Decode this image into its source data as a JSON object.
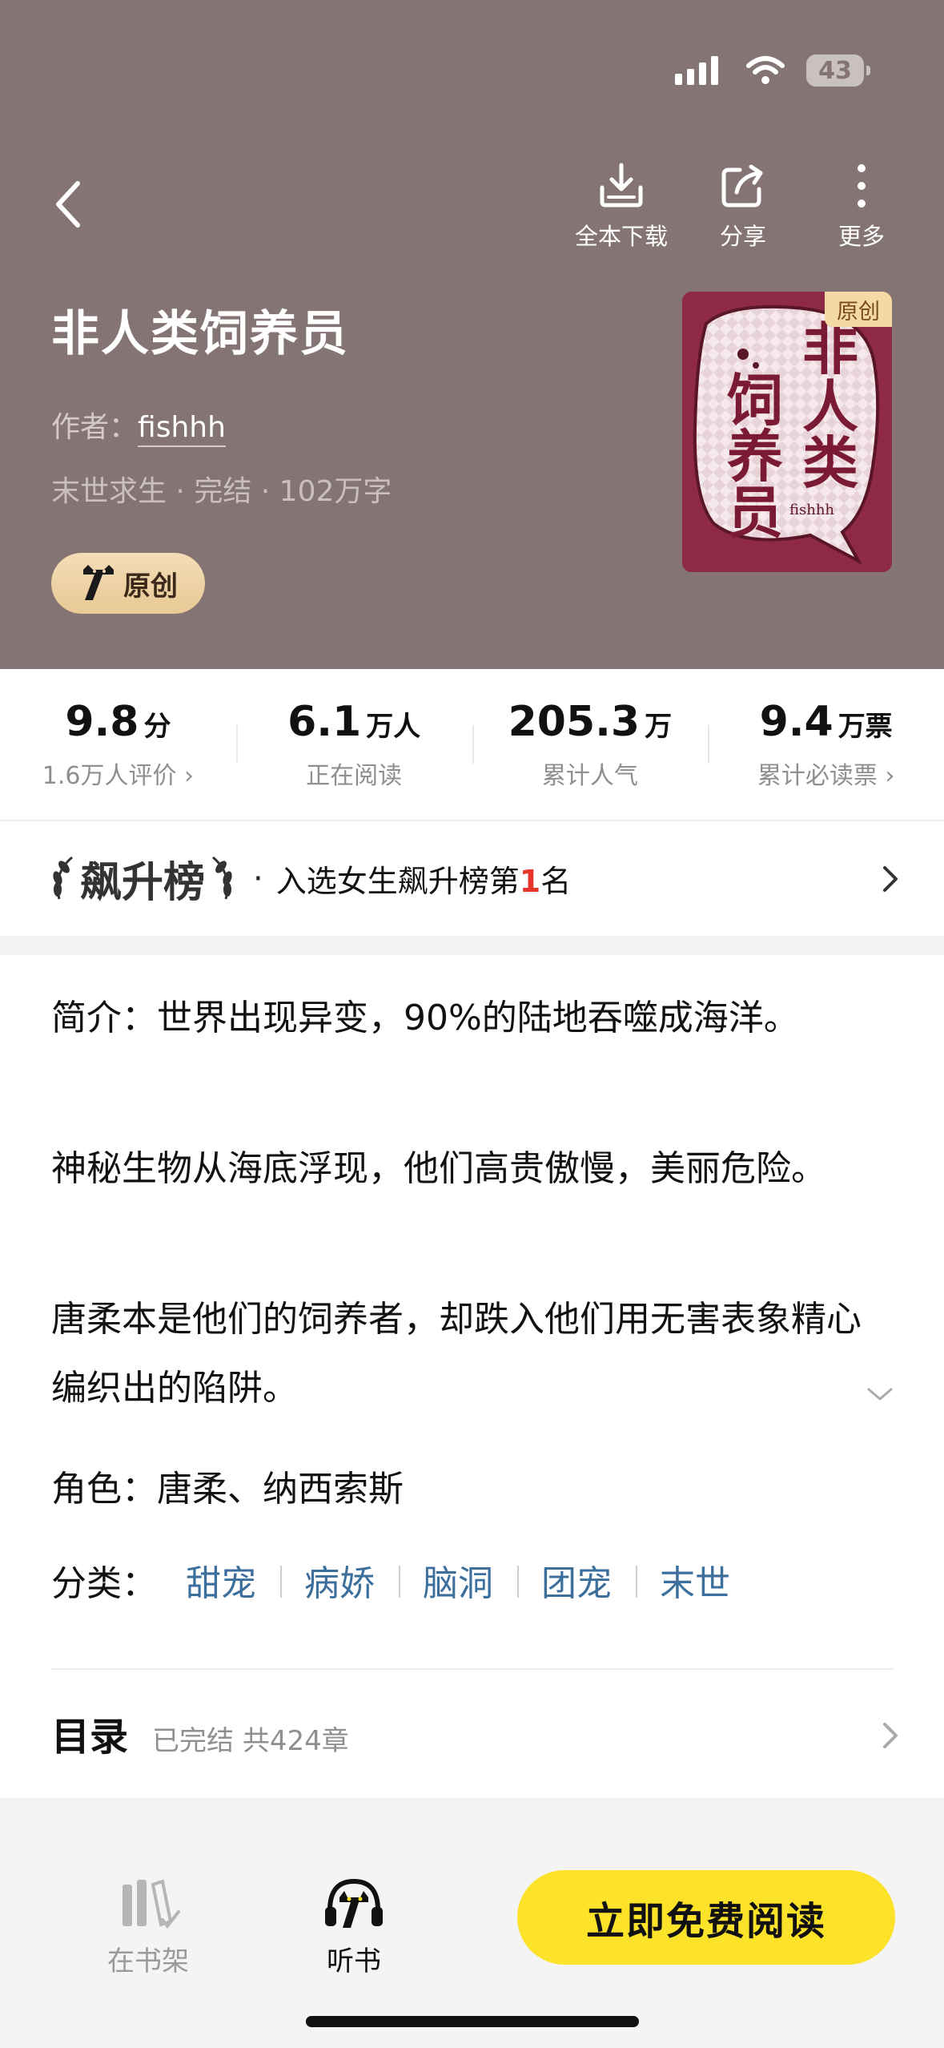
{
  "status_bar": {
    "battery": "43"
  },
  "toolbar": {
    "download_label": "全本下载",
    "share_label": "分享",
    "more_label": "更多"
  },
  "book": {
    "title": "非人类饲养员",
    "author_prefix": "作者：",
    "author": "fishhh",
    "meta": "末世求生 · 完结 · 102万字",
    "badge_label": "原创",
    "cover": {
      "tag": "原创",
      "title_chars": [
        "非",
        "人",
        "类",
        "饲",
        "养",
        "员"
      ],
      "author_mark": "fishhh"
    }
  },
  "stats": [
    {
      "num": "9.8",
      "unit": "分",
      "caption": "1.6万人评价"
    },
    {
      "num": "6.1",
      "unit": "万人",
      "caption": "正在阅读"
    },
    {
      "num": "205.3",
      "unit": "万",
      "caption": "累计人气"
    },
    {
      "num": "9.4",
      "unit": "万票",
      "caption": "累计必读票"
    }
  ],
  "rank": {
    "logo_text": "飙升榜",
    "dot": "·",
    "text_before": "入选女生飙升榜第",
    "rank_number": "1",
    "text_after": "名"
  },
  "intro": {
    "p1": "简介：世界出现异变，90%的陆地吞噬成海洋。",
    "p2": "神秘生物从海底浮现，他们高贵傲慢，美丽危险。",
    "p3": "唐柔本是他们的饲养者，却跌入他们用无害表象精心编织出的陷阱。",
    "role": "角色：唐柔、纳西索斯",
    "category_key": "分类：",
    "categories": [
      "甜宠",
      "病娇",
      "脑洞",
      "团宠",
      "末世"
    ]
  },
  "toc": {
    "title": "目录",
    "status": "已完结 共424章"
  },
  "bottom_bar": {
    "shelf_label": "在书架",
    "listen_label": "听书",
    "read_button": "立即免费阅读"
  },
  "colors": {
    "header_bg": "#857474",
    "accent_yellow": "#fde22a",
    "link_blue": "#3d6f9c",
    "rank_red": "#e6352b"
  }
}
